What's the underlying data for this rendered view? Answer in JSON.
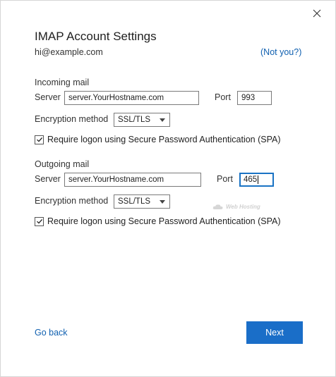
{
  "dialog": {
    "title": "IMAP Account Settings",
    "email": "hi@example.com",
    "not_you_link": "(Not you?)",
    "close_icon": "close-icon"
  },
  "incoming": {
    "heading": "Incoming mail",
    "server_label": "Server",
    "server_value": "server.YourHostname.com",
    "port_label": "Port",
    "port_value": "993",
    "encryption_label": "Encryption method",
    "encryption_value": "SSL/TLS",
    "spa_label": "Require logon using Secure Password Authentication (SPA)",
    "spa_checked": true
  },
  "outgoing": {
    "heading": "Outgoing mail",
    "server_label": "Server",
    "server_value": "server.YourHostname.com",
    "port_label": "Port",
    "port_value": "465",
    "encryption_label": "Encryption method",
    "encryption_value": "SSL/TLS",
    "spa_label": "Require logon using Secure Password Authentication (SPA)",
    "spa_checked": true
  },
  "watermark": "Web Hosting",
  "footer": {
    "go_back": "Go back",
    "next": "Next"
  },
  "colors": {
    "accent": "#1a6ec8",
    "link": "#1060b0",
    "focus_border": "#1a73c4"
  }
}
